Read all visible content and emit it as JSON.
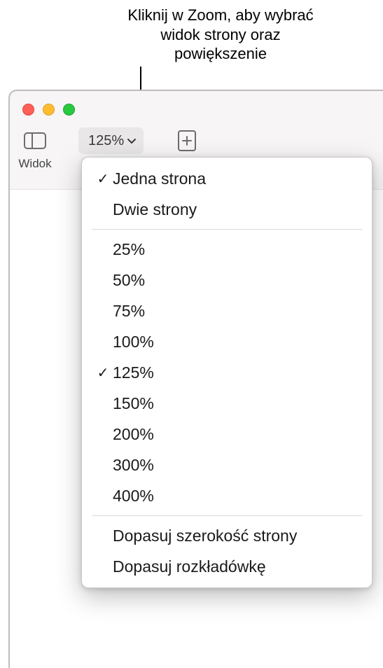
{
  "callout": {
    "text": "Kliknij w Zoom, aby wybrać widok strony oraz powiększenie"
  },
  "toolbar": {
    "view_label": "Widok",
    "zoom_value": "125%"
  },
  "menu": {
    "page_views": [
      {
        "label": "Jedna strona",
        "checked": true
      },
      {
        "label": "Dwie strony",
        "checked": false
      }
    ],
    "zoom_levels": [
      {
        "label": "25%",
        "checked": false
      },
      {
        "label": "50%",
        "checked": false
      },
      {
        "label": "75%",
        "checked": false
      },
      {
        "label": "100%",
        "checked": false
      },
      {
        "label": "125%",
        "checked": true
      },
      {
        "label": "150%",
        "checked": false
      },
      {
        "label": "200%",
        "checked": false
      },
      {
        "label": "300%",
        "checked": false
      },
      {
        "label": "400%",
        "checked": false
      }
    ],
    "fit_options": [
      {
        "label": "Dopasuj szerokość strony"
      },
      {
        "label": "Dopasuj rozkładówkę"
      }
    ]
  },
  "glyphs": {
    "check": "✓"
  }
}
